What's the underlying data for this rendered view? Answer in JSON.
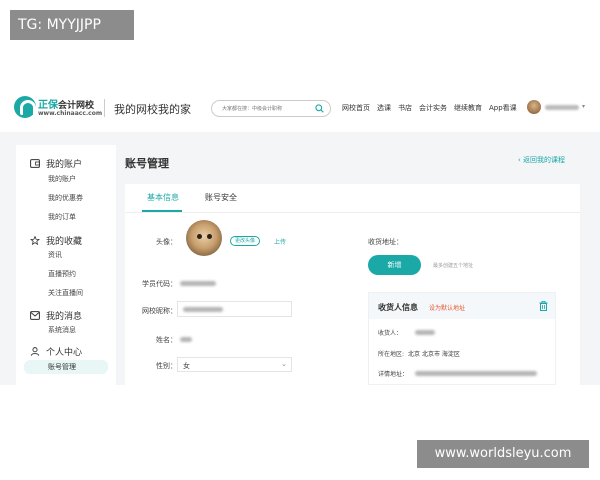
{
  "watermarks": {
    "top_left": "TG: MYYJJPP",
    "bottom_right": "www.worldsleyu.com"
  },
  "header": {
    "logo_main": "正保",
    "logo_sub": "会计网校",
    "logo_url": "www.chinaacc.com",
    "slogan": "我的网校我的家",
    "search_placeholder": "大家都在搜：中级会计职称",
    "nav": [
      "网校首页",
      "选课",
      "书店",
      "会计实务",
      "继续教育",
      "App看课"
    ]
  },
  "sidebar": {
    "groups": [
      {
        "label": "我的账户",
        "icon": "wallet-icon",
        "items": [
          "我的账户",
          "我的优惠券",
          "我的订单"
        ]
      },
      {
        "label": "我的收藏",
        "icon": "star-icon",
        "items": [
          "资讯",
          "直播预约",
          "关注直播间"
        ]
      },
      {
        "label": "我的消息",
        "icon": "mail-icon",
        "items": [
          "系统消息"
        ]
      },
      {
        "label": "个人中心",
        "icon": "user-icon",
        "items": [
          "账号管理"
        ]
      }
    ],
    "active_item": "账号管理"
  },
  "main": {
    "title": "账号管理",
    "back_link": "‹ 返回我的课程",
    "tabs": [
      "基本信息",
      "账号安全"
    ],
    "active_tab": "基本信息",
    "form": {
      "avatar_label": "头像：",
      "change_avatar_button": "更改头像",
      "upload_link": "上传",
      "student_code_label": "学员代码：",
      "nickname_label": "网校昵称：",
      "name_label": "姓名：",
      "gender_label": "性别：",
      "gender_value": "女"
    },
    "address": {
      "label": "收货地址：",
      "new_button": "新增",
      "hint": "最多创建五个地址",
      "card": {
        "title": "收货人信息",
        "default_link": "设为默认地址",
        "recipient_label": "收货人：",
        "region_label": "所在地区:",
        "region_value": "北京 北京市 海淀区",
        "detail_label": "详情地址："
      }
    }
  },
  "colors": {
    "accent": "#1aa9a6",
    "warning": "#e8572e",
    "band": "#f4f5f7"
  }
}
